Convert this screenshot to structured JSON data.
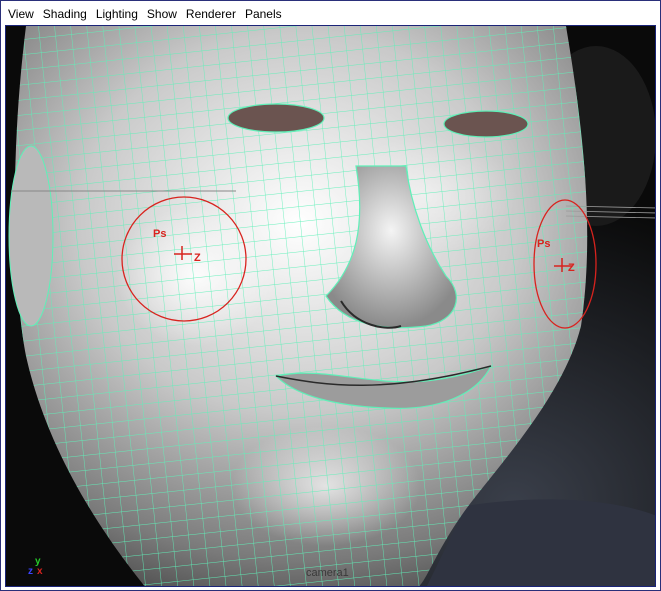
{
  "menubar": {
    "items": [
      "View",
      "Shading",
      "Lighting",
      "Show",
      "Renderer",
      "Panels"
    ]
  },
  "viewport": {
    "left_marker": {
      "label": "Ps",
      "axis": "Z"
    },
    "right_marker": {
      "label": "Ps",
      "axis": "Z"
    },
    "axes": {
      "y": "y",
      "z": "z",
      "x": "x"
    },
    "camera": "camera1"
  },
  "colors": {
    "wireframe": "#5ff0b8",
    "marker": "#d8231e",
    "background": "#0c0c0c",
    "menubar": "#ffffff"
  }
}
